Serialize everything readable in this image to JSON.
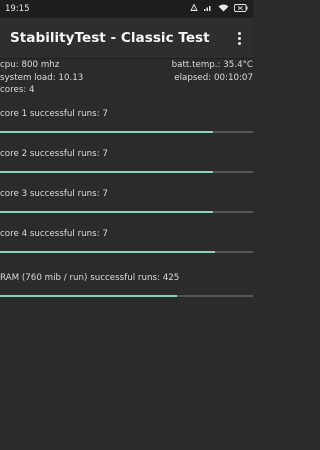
{
  "status": {
    "time": "19:15",
    "battery": "✕"
  },
  "appbar": {
    "title": "StabilityTest - Classic Test"
  },
  "info": {
    "cpu": "cpu: 800 mhz",
    "batt_temp": "batt.temp.: 35.4°C",
    "system_load": "system load: 10.13",
    "elapsed": "elapsed: 00:10:07",
    "cores": "cores: 4"
  },
  "runs": [
    {
      "label": "core 1 successful runs: 7",
      "progress": 0.84
    },
    {
      "label": "core 2 successful runs: 7",
      "progress": 0.84
    },
    {
      "label": "core 3 successful runs: 7",
      "progress": 0.84
    },
    {
      "label": "core 4 successful runs: 7",
      "progress": 0.85
    },
    {
      "label": "RAM (760 mib / run) successful runs: 425",
      "progress": 0.7
    }
  ],
  "colors": {
    "progress_fill": "#8ad4c0",
    "progress_track": "#555555"
  }
}
